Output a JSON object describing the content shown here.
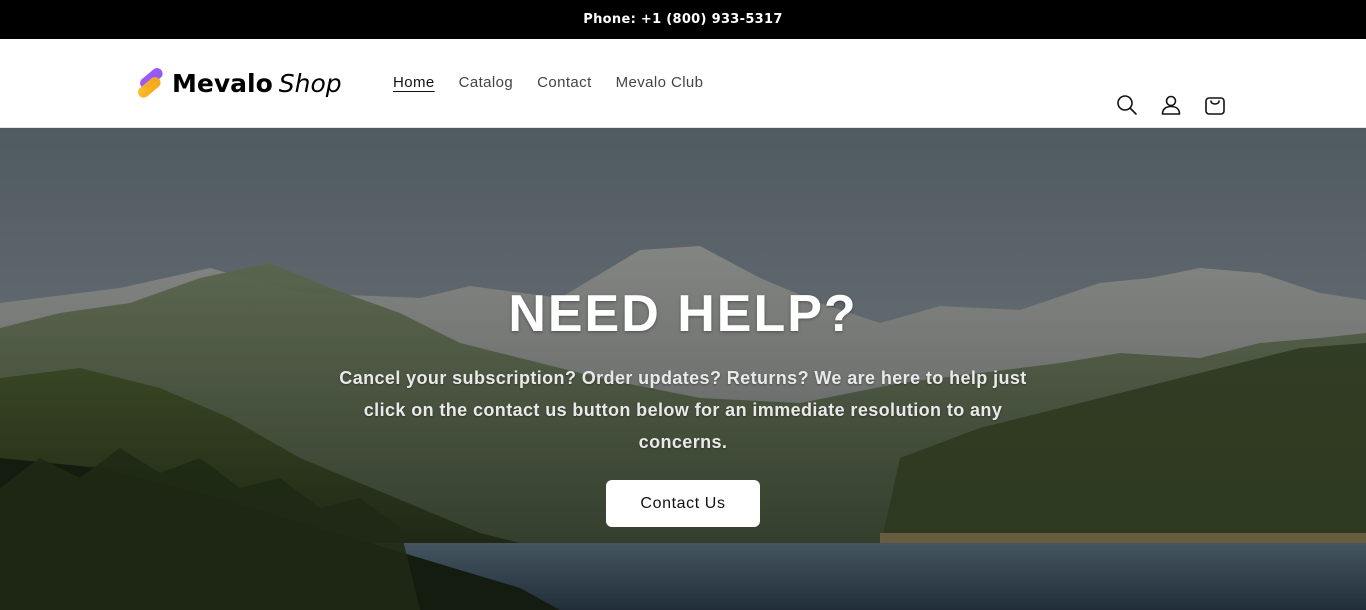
{
  "announcement": {
    "text": "Phone: +1 (800) 933-5317"
  },
  "header": {
    "logo": {
      "brand": "Mevalo",
      "suffix": "Shop"
    },
    "nav": [
      {
        "label": "Home",
        "active": true
      },
      {
        "label": "Catalog",
        "active": false
      },
      {
        "label": "Contact",
        "active": false
      },
      {
        "label": "Mevalo Club",
        "active": false
      }
    ],
    "icons": [
      "search-icon",
      "account-icon",
      "cart-icon"
    ]
  },
  "hero": {
    "title": "NEED HELP?",
    "text": "Cancel your subscription? Order updates? Returns? We are here to help just click on the contact us button below for an immediate resolution to any concerns.",
    "button_label": "Contact Us"
  },
  "colors": {
    "announcement_bg": "#000000",
    "logo_gradient": [
      "#8b5cf6",
      "#f59e0b"
    ],
    "button_bg": "#ffffff"
  }
}
